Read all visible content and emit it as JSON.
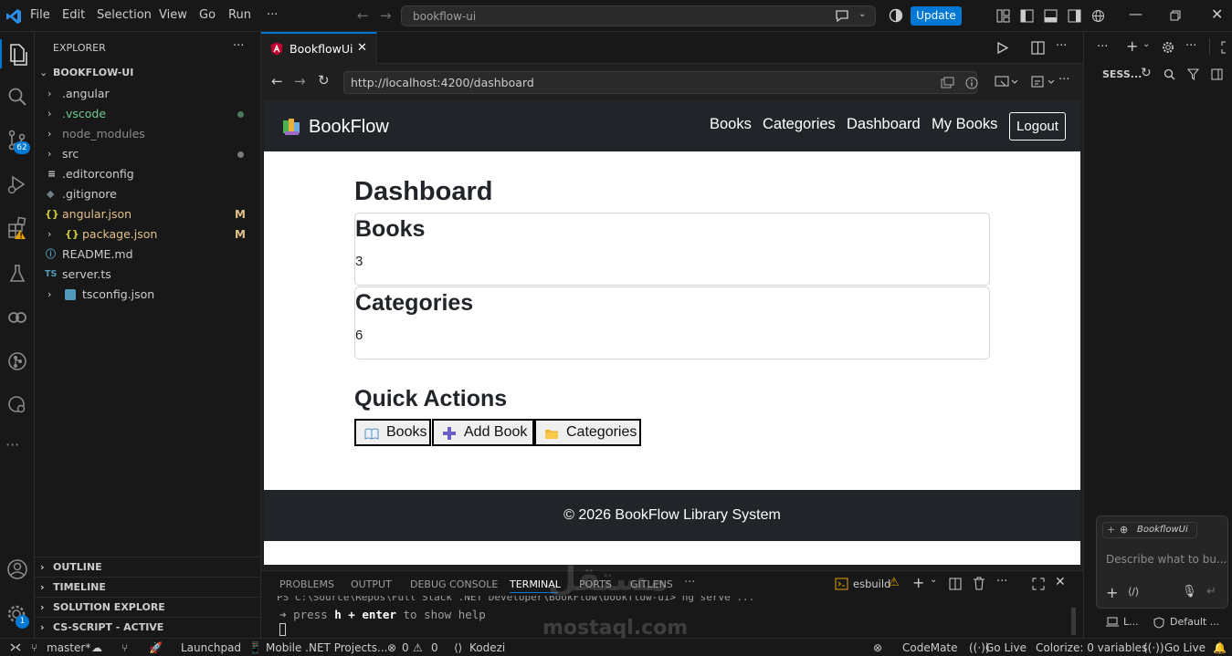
{
  "titlebar": {
    "menu": [
      "File",
      "Edit",
      "Selection",
      "View",
      "Go",
      "Run",
      "···"
    ],
    "search": "bookflow-ui",
    "update_label": "Update"
  },
  "activity": {
    "scm_badge": "62",
    "account_badge": "1"
  },
  "explorer": {
    "header": "EXPLORER",
    "more": "···",
    "root": "BOOKFLOW-UI",
    "items": [
      {
        "name": ".angular",
        "icon": "chevron-right-icon",
        "mark": ""
      },
      {
        "name": ".vscode",
        "icon": "chevron-right-icon",
        "mark": "dot"
      },
      {
        "name": "node_modules",
        "icon": "chevron-right-icon",
        "mark": ""
      },
      {
        "name": "src",
        "icon": "chevron-right-icon",
        "mark": "dot"
      },
      {
        "name": ".editorconfig",
        "icon": "lines-icon",
        "mark": ""
      },
      {
        "name": ".gitignore",
        "icon": "git-icon",
        "mark": ""
      },
      {
        "name": "angular.json",
        "icon": "json-icon",
        "mark": "M"
      },
      {
        "name": "package.json",
        "icon": "json-icon",
        "mark": "M"
      },
      {
        "name": "README.md",
        "icon": "info-icon",
        "mark": ""
      },
      {
        "name": "server.ts",
        "icon": "ts-icon",
        "mark": ""
      },
      {
        "name": "tsconfig.json",
        "icon": "ts-config-icon",
        "mark": ""
      }
    ],
    "mark_M": "M",
    "ts_label": "TS",
    "json_label": "{}",
    "sections": [
      "OUTLINE",
      "TIMELINE",
      "SOLUTION EXPLORE",
      "CS-SCRIPT - ACTIVE"
    ]
  },
  "editor": {
    "tab_label": "BookflowUi",
    "url": "http://localhost:4200/dashboard"
  },
  "webpage": {
    "brand": "BookFlow",
    "nav": [
      "Books",
      "Categories",
      "Dashboard",
      "My Books"
    ],
    "logout": "Logout",
    "title": "Dashboard",
    "cards": [
      {
        "title": "Books",
        "value": "3"
      },
      {
        "title": "Categories",
        "value": "6"
      }
    ],
    "quick_actions_title": "Quick Actions",
    "quick_actions": [
      {
        "icon": "book-icon",
        "label": "Books"
      },
      {
        "icon": "plus-icon",
        "label": "Add Book"
      },
      {
        "icon": "folder-icon",
        "label": "Categories"
      }
    ],
    "footer": "© 2026 BookFlow Library System"
  },
  "panel": {
    "tabs": [
      "PROBLEMS",
      "OUTPUT",
      "DEBUG CONSOLE",
      "TERMINAL",
      "PORTS",
      "GITLENS",
      "···"
    ],
    "active_tab": "TERMINAL",
    "terminal_name": "esbuild",
    "terminal_line1": "PS C:\\Source\\Repos\\Full Stack .NET Developer\\BookFlow\\bookflow-ui> ng serve ...",
    "terminal_line2_arrow": "➜",
    "terminal_line2_press": "press",
    "terminal_line2_key": "h + enter",
    "terminal_line2_rest": "to show help"
  },
  "rightpanel": {
    "header": "SESS...",
    "chat_context": "BookflowUi",
    "chat_placeholder": "Describe what to bu...",
    "bottom_left": "L...",
    "bottom_right": "Default ..."
  },
  "statusbar": {
    "branch": "master*",
    "launchpad": "Launchpad",
    "mobile": "Mobile .NET Projects...",
    "errors": "0",
    "warnings": "0",
    "kodezi": "Kodezi",
    "codemate": "CodeMate",
    "golive1": "Go Live",
    "colorize": "Colorize: 0 variables",
    "golive2": "Go Live"
  },
  "watermark": {
    "arabic": "مستقل",
    "latin": "mostaql.com"
  }
}
